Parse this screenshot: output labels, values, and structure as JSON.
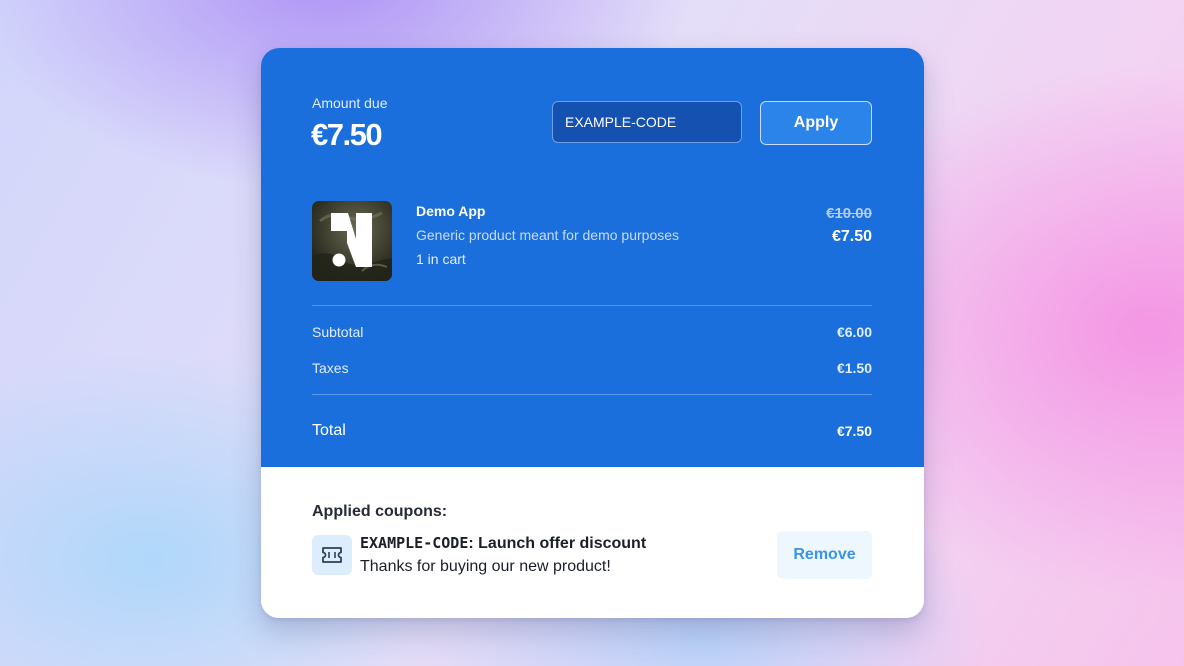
{
  "summary": {
    "amount_label": "Amount due",
    "amount_value": "€7.50"
  },
  "coupon_form": {
    "input_value": "EXAMPLE-CODE",
    "apply_label": "Apply"
  },
  "product": {
    "name": "Demo App",
    "description": "Generic product meant for demo purposes",
    "quantity": "1 in cart",
    "original_price": "€10.00",
    "price": "€7.50",
    "thumbnail_icon": "app-logo-n-icon"
  },
  "totals": {
    "subtotal_label": "Subtotal",
    "subtotal_value": "€6.00",
    "taxes_label": "Taxes",
    "taxes_value": "€1.50",
    "total_label": "Total",
    "total_value": "€7.50"
  },
  "applied_coupons": {
    "title": "Applied coupons:",
    "items": [
      {
        "code": "EXAMPLE-CODE",
        "separator": ":",
        "name": " Launch offer discount",
        "description": "Thanks for buying our new product!",
        "icon": "ticket-icon",
        "remove_label": "Remove"
      }
    ]
  },
  "colors": {
    "accent_blue": "#1a6fdc",
    "apply_button": "#2b84ea",
    "remove_text": "#3b94e8"
  }
}
